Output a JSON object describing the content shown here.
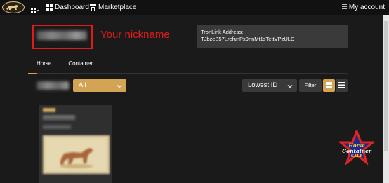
{
  "nav": {
    "dashboard_label": "Dashboard",
    "marketplace_label": "Marketplace",
    "account_label": "My account"
  },
  "profile": {
    "nickname_annotation": "Your nickname",
    "tron_label": "TronLink Address:",
    "tron_address": "TJbzeB57LrefunPx9nnMt1sTettVPzULD"
  },
  "tabs": [
    {
      "label": "Horse",
      "active": true
    },
    {
      "label": "Container",
      "active": false
    }
  ],
  "filters": {
    "type_selected": "All",
    "sort_selected": "Lowest ID",
    "filter_label": "Filter",
    "view_mode": "grid"
  },
  "promo": {
    "line1": "Horse",
    "line2": "Container",
    "line3": "SALE"
  },
  "colors": {
    "accent_gold": "#d3a453",
    "annotation_red": "#e11b1b",
    "background": "#1a1a1a",
    "panel": "#3a3a3a"
  },
  "icons": [
    "logo-icon",
    "grid-menu-icon",
    "dashboard-icon",
    "marketplace-icon",
    "hamburger-icon",
    "chevron-down-icon",
    "grid-view-icon",
    "list-view-icon",
    "promo-star-icon"
  ]
}
